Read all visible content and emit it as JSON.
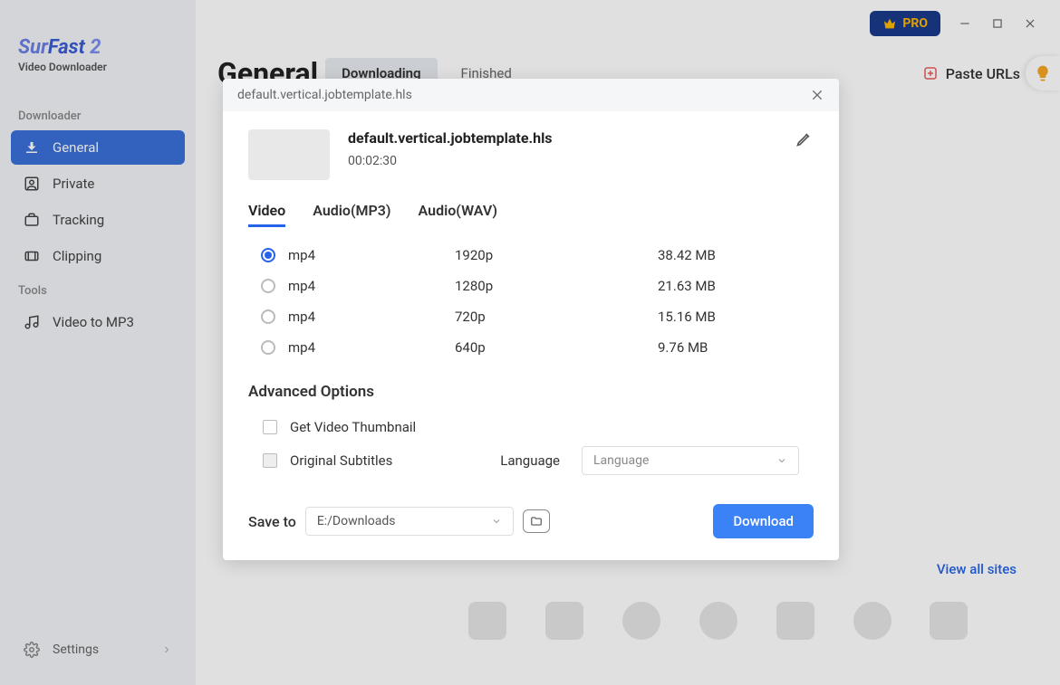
{
  "app": {
    "logo_sur": "Sur",
    "logo_fast": "Fast",
    "logo_two": " 2",
    "logo_sub": "Video Downloader"
  },
  "sidebar": {
    "section_downloader": "Downloader",
    "section_tools": "Tools",
    "items": {
      "general": "General",
      "private": "Private",
      "tracking": "Tracking",
      "clipping": "Clipping",
      "video_to_mp3": "Video to MP3"
    },
    "settings": "Settings"
  },
  "titlebar": {
    "pro": "PRO"
  },
  "header": {
    "title": "General",
    "tab_downloading": "Downloading",
    "tab_finished": "Finished",
    "paste_urls": "Paste URLs"
  },
  "view_all": "View all sites",
  "modal": {
    "header_title": "default.vertical.jobtemplate.hls",
    "item_title": "default.vertical.jobtemplate.hls",
    "duration": "00:02:30",
    "tabs": {
      "video": "Video",
      "audio_mp3": "Audio(MP3)",
      "audio_wav": "Audio(WAV)"
    },
    "rows": [
      {
        "format": "mp4",
        "res": "1920p",
        "size": "38.42 MB",
        "selected": true
      },
      {
        "format": "mp4",
        "res": "1280p",
        "size": "21.63 MB",
        "selected": false
      },
      {
        "format": "mp4",
        "res": "720p",
        "size": "15.16 MB",
        "selected": false
      },
      {
        "format": "mp4",
        "res": "640p",
        "size": "9.76 MB",
        "selected": false
      }
    ],
    "advanced_title": "Advanced Options",
    "opt_thumbnail": "Get Video Thumbnail",
    "opt_subtitles": "Original Subtitles",
    "language_label": "Language",
    "language_placeholder": "Language",
    "save_to_label": "Save to",
    "save_path": "E:/Downloads",
    "download_btn": "Download"
  }
}
